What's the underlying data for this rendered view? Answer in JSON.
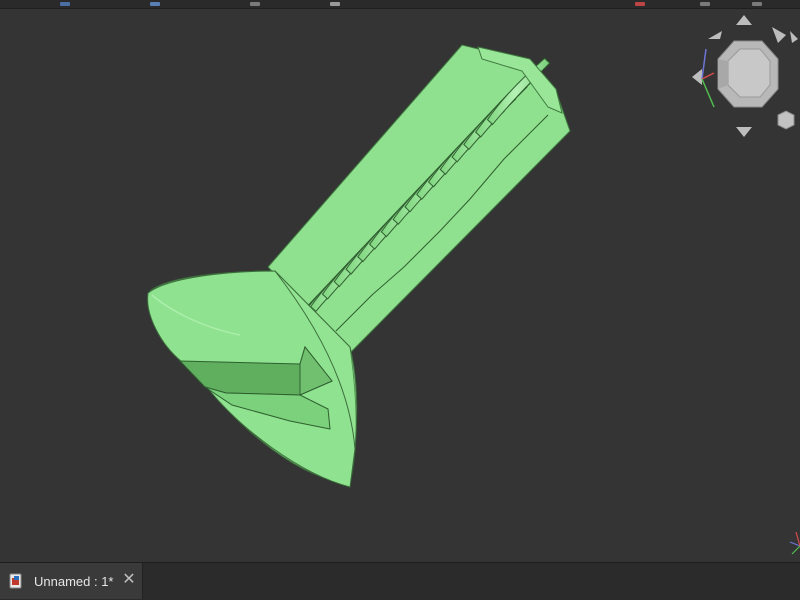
{
  "colors": {
    "viewport_background": "#343434",
    "model_fill": "#8de38d",
    "model_shade": "#6fce6f",
    "model_edge": "#3b6d3b"
  },
  "viewport": {
    "model": "countersunk-slotted-screw",
    "navigation": "navigation-cube"
  },
  "tabs": [
    {
      "label": "Unnamed : 1*",
      "icon": "freecad-document-icon",
      "active": true
    }
  ]
}
